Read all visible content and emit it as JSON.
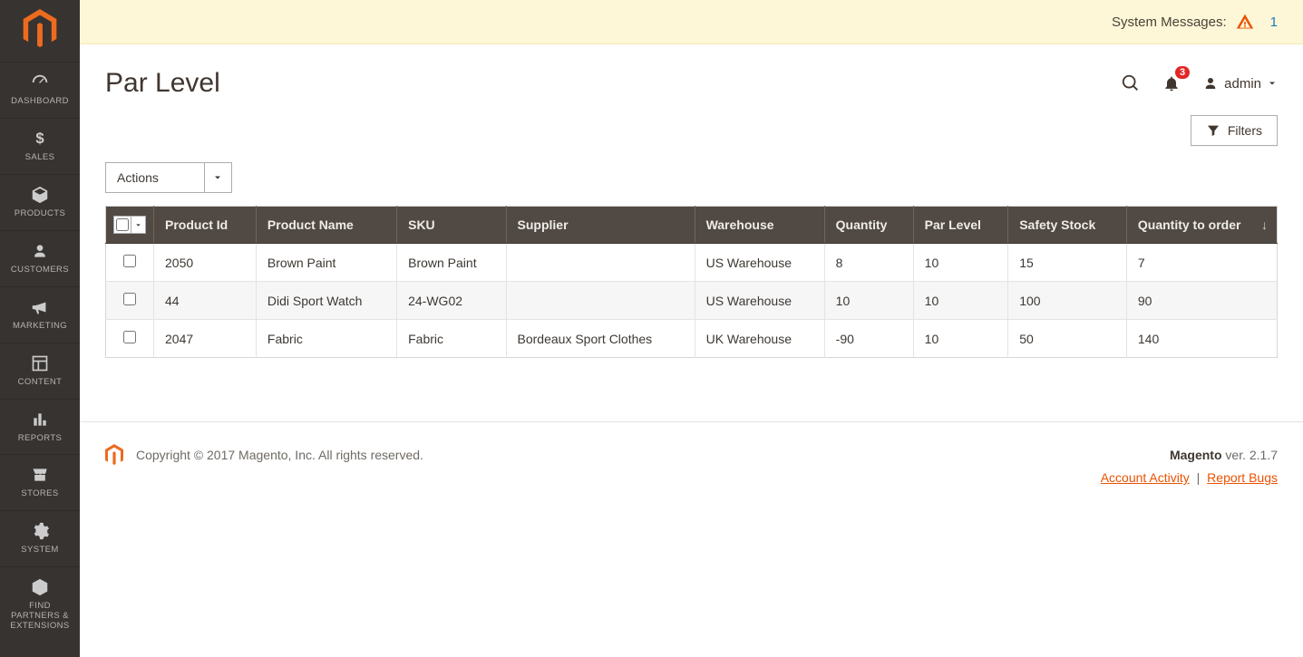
{
  "sidebar": {
    "items": [
      {
        "label": "DASHBOARD"
      },
      {
        "label": "SALES"
      },
      {
        "label": "PRODUCTS"
      },
      {
        "label": "CUSTOMERS"
      },
      {
        "label": "MARKETING"
      },
      {
        "label": "CONTENT"
      },
      {
        "label": "REPORTS"
      },
      {
        "label": "STORES"
      },
      {
        "label": "SYSTEM"
      },
      {
        "label": "FIND PARTNERS & EXTENSIONS"
      }
    ]
  },
  "systemMessages": {
    "label": "System Messages:",
    "count": "1"
  },
  "header": {
    "title": "Par Level",
    "notificationCount": "3",
    "adminUser": "admin"
  },
  "toolbar": {
    "filters": "Filters",
    "actionsLabel": "Actions"
  },
  "table": {
    "columns": {
      "product_id": "Product Id",
      "product_name": "Product Name",
      "sku": "SKU",
      "supplier": "Supplier",
      "warehouse": "Warehouse",
      "quantity": "Quantity",
      "par_level": "Par Level",
      "safety_stock": "Safety Stock",
      "qty_to_order": "Quantity to order"
    },
    "rows": [
      {
        "product_id": "2050",
        "product_name": "Brown Paint",
        "sku": "Brown Paint",
        "supplier": "",
        "warehouse": "US Warehouse",
        "quantity": "8",
        "par_level": "10",
        "safety_stock": "15",
        "qty_to_order": "7"
      },
      {
        "product_id": "44",
        "product_name": "Didi Sport Watch",
        "sku": "24-WG02",
        "supplier": "",
        "warehouse": "US Warehouse",
        "quantity": "10",
        "par_level": "10",
        "safety_stock": "100",
        "qty_to_order": "90"
      },
      {
        "product_id": "2047",
        "product_name": "Fabric",
        "sku": "Fabric",
        "supplier": "Bordeaux Sport Clothes",
        "warehouse": "UK Warehouse",
        "quantity": "-90",
        "par_level": "10",
        "safety_stock": "50",
        "qty_to_order": "140"
      }
    ]
  },
  "footer": {
    "copyright": "Copyright © 2017 Magento, Inc. All rights reserved.",
    "versionLabel": "Magento",
    "versionSuffix": " ver. 2.1.7",
    "accountActivity": "Account Activity",
    "reportBugs": "Report Bugs"
  }
}
